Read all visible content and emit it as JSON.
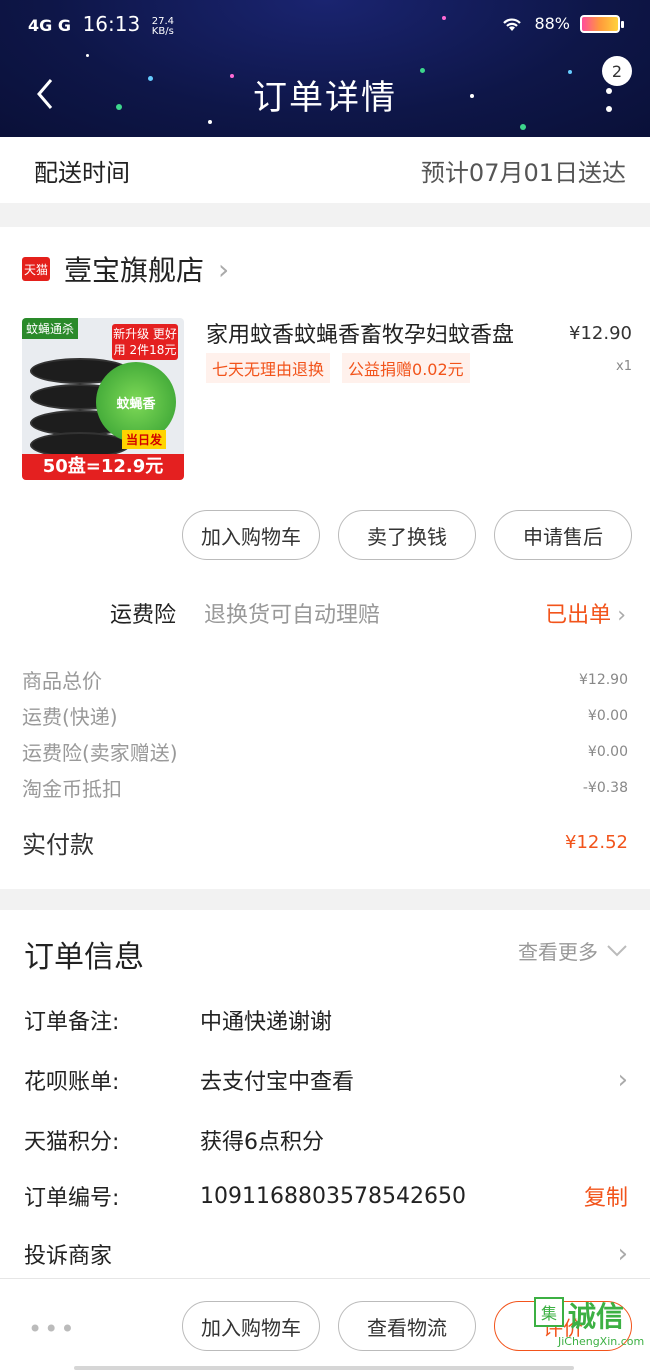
{
  "status_bar": {
    "network": "4G",
    "carrier_g": "G",
    "time": "16:13",
    "speed_value": "27.4",
    "speed_unit": "KB/s",
    "battery": "88%"
  },
  "header": {
    "title": "订单详情",
    "badge_count": "2"
  },
  "delivery": {
    "label": "配送时间",
    "value": "预计07月01日送达"
  },
  "shop": {
    "logo_text": "天猫",
    "name": "壹宝旗舰店"
  },
  "product": {
    "image_top_text": "蚊蝇通杀",
    "image_promo_text": "新升级 更好用 2件18元",
    "image_circle_text": "蚊蝇香",
    "image_today_text": "当日发",
    "image_banner": "50盘=12.9元",
    "title": "家用蚊香蚊蝇香畜牧孕妇蚊香盘",
    "price": "¥12.90",
    "quantity": "x1",
    "tags": [
      "七天无理由退换",
      "公益捐赠0.02元"
    ]
  },
  "actions": {
    "add_cart": "加入购物车",
    "resell": "卖了换钱",
    "after_sale": "申请售后"
  },
  "insurance": {
    "label": "运费险",
    "desc": "退换货可自动理赔",
    "status": "已出单"
  },
  "costs": [
    {
      "label": "商品总价",
      "value": "¥12.90"
    },
    {
      "label": "运费(快递)",
      "value": "¥0.00"
    },
    {
      "label": "运费险(卖家赠送)",
      "value": "¥0.00"
    },
    {
      "label": "淘金币抵扣",
      "value": "-¥0.38"
    }
  ],
  "total": {
    "label": "实付款",
    "value": "¥12.52"
  },
  "order_info": {
    "title": "订单信息",
    "view_more": "查看更多",
    "rows": [
      {
        "label": "订单备注:",
        "value": "中通快递谢谢"
      },
      {
        "label": "花呗账单:",
        "value": "去支付宝中查看"
      },
      {
        "label": "天猫积分:",
        "value": "获得6点积分"
      },
      {
        "label": "订单编号:",
        "value": "1091168803578542650",
        "action": "复制"
      },
      {
        "label": "投诉商家",
        "value": ""
      }
    ]
  },
  "bottom_bar": {
    "more": "•••",
    "add_cart": "加入购物车",
    "logistics": "查看物流",
    "review": "评价"
  },
  "watermark": {
    "logo": "集",
    "text": "诚信",
    "sub": "JiChengXin.com"
  },
  "colors": {
    "header_bg": "#0e1648",
    "accent": "#f2541b",
    "tmall_red": "#e4201b"
  }
}
